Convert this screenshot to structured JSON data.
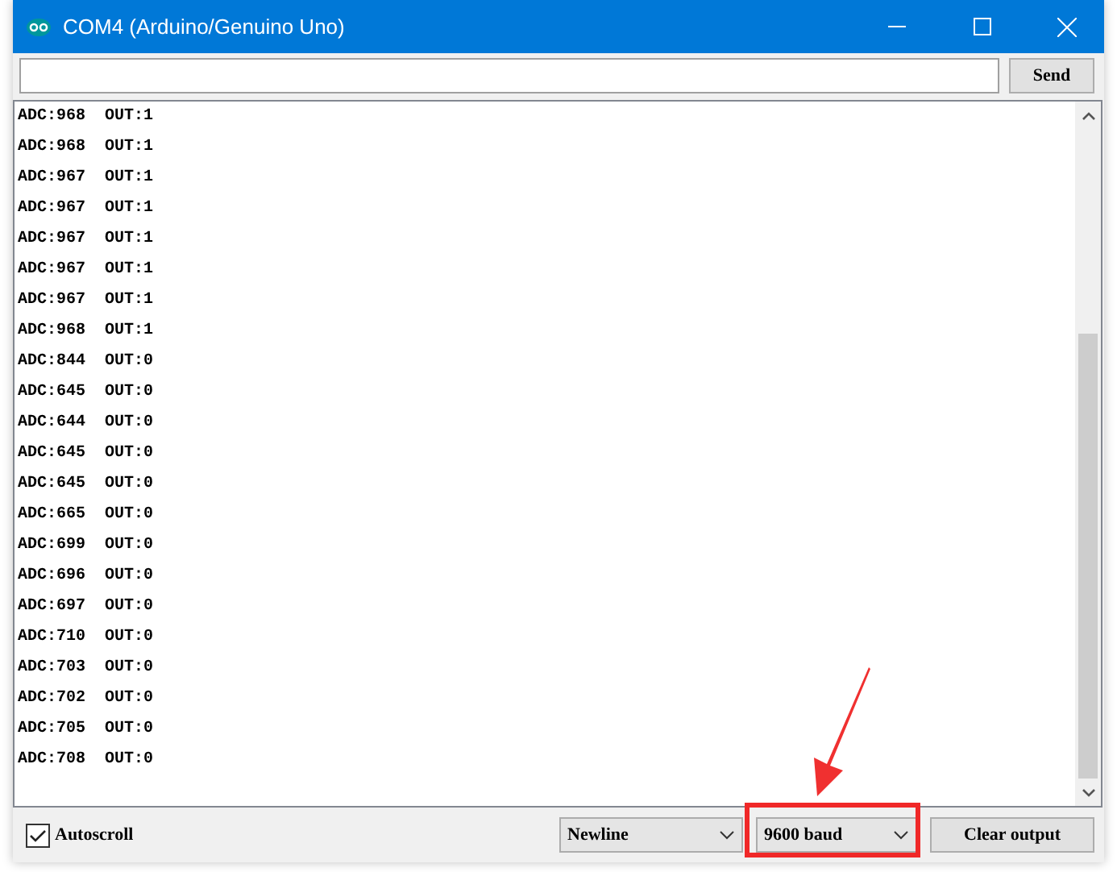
{
  "window": {
    "title": "COM4 (Arduino/Genuino Uno)"
  },
  "send_button": "Send",
  "output_lines": [
    "ADC:968  OUT:1",
    "ADC:968  OUT:1",
    "ADC:967  OUT:1",
    "ADC:967  OUT:1",
    "ADC:967  OUT:1",
    "ADC:967  OUT:1",
    "ADC:967  OUT:1",
    "ADC:968  OUT:1",
    "ADC:844  OUT:0",
    "ADC:645  OUT:0",
    "ADC:644  OUT:0",
    "ADC:645  OUT:0",
    "ADC:645  OUT:0",
    "ADC:665  OUT:0",
    "ADC:699  OUT:0",
    "ADC:696  OUT:0",
    "ADC:697  OUT:0",
    "ADC:710  OUT:0",
    "ADC:703  OUT:0",
    "ADC:702  OUT:0",
    "ADC:705  OUT:0",
    "ADC:708  OUT:0"
  ],
  "autoscroll": {
    "label": "Autoscroll",
    "checked": true
  },
  "line_ending": {
    "value": "Newline"
  },
  "baud_rate": {
    "value": "9600 baud",
    "highlighted": true
  },
  "clear_button": "Clear output"
}
